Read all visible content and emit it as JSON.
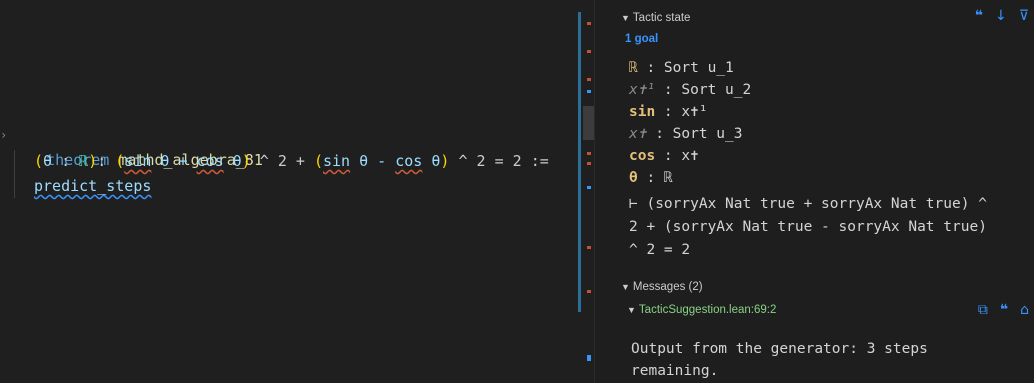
{
  "editor": {
    "line1": {
      "kw": "theorem",
      "name": "mathd_algebra_81"
    },
    "line2": {
      "p1": "(",
      "theta1": "θ",
      "colon": " : ",
      "real": "ℝ",
      "p2": ")",
      "colon2": ": ",
      "p3": "(",
      "sin1": "sin",
      "t1": " θ + ",
      "cos1": "cos",
      "t2": " θ",
      "p4": ")",
      "t3": " ^ 2 + ",
      "p5": "(",
      "sin2": "sin",
      "t4": " θ - ",
      "cos2": "cos",
      "t5": " θ",
      "p6": ")",
      "t6": " ^ 2 = 2 :="
    },
    "line3": "predict_steps"
  },
  "infoview": {
    "tactic_state_label": "Tactic state",
    "goal_count": "1 goal",
    "hyps": [
      {
        "name": "ℝ",
        "rest": " : Sort u_1"
      },
      {
        "name": "x✝¹",
        "rest": " : Sort u_2"
      },
      {
        "name": "sin",
        "rest": " : x✝¹"
      },
      {
        "name": "x✝",
        "rest": " : Sort u_3"
      },
      {
        "name": "cos",
        "rest": " : x✝"
      },
      {
        "name": "θ",
        "rest": " : ℝ"
      }
    ],
    "goal_lines": [
      "⊢ (sorryAx Nat true + sorryAx Nat true) ^",
      "2 + (sorryAx Nat true - sorryAx Nat true)",
      "^ 2 = 2"
    ],
    "messages_label": "Messages (2)",
    "message_source": "TacticSuggestion.lean:69:2",
    "message_lines": [
      "Output from the generator: 3 steps",
      "remaining."
    ],
    "icons": {
      "quote": "❝",
      "down": "↓",
      "filter": "⊽",
      "copy": "⧉",
      "home": "⌂"
    }
  }
}
